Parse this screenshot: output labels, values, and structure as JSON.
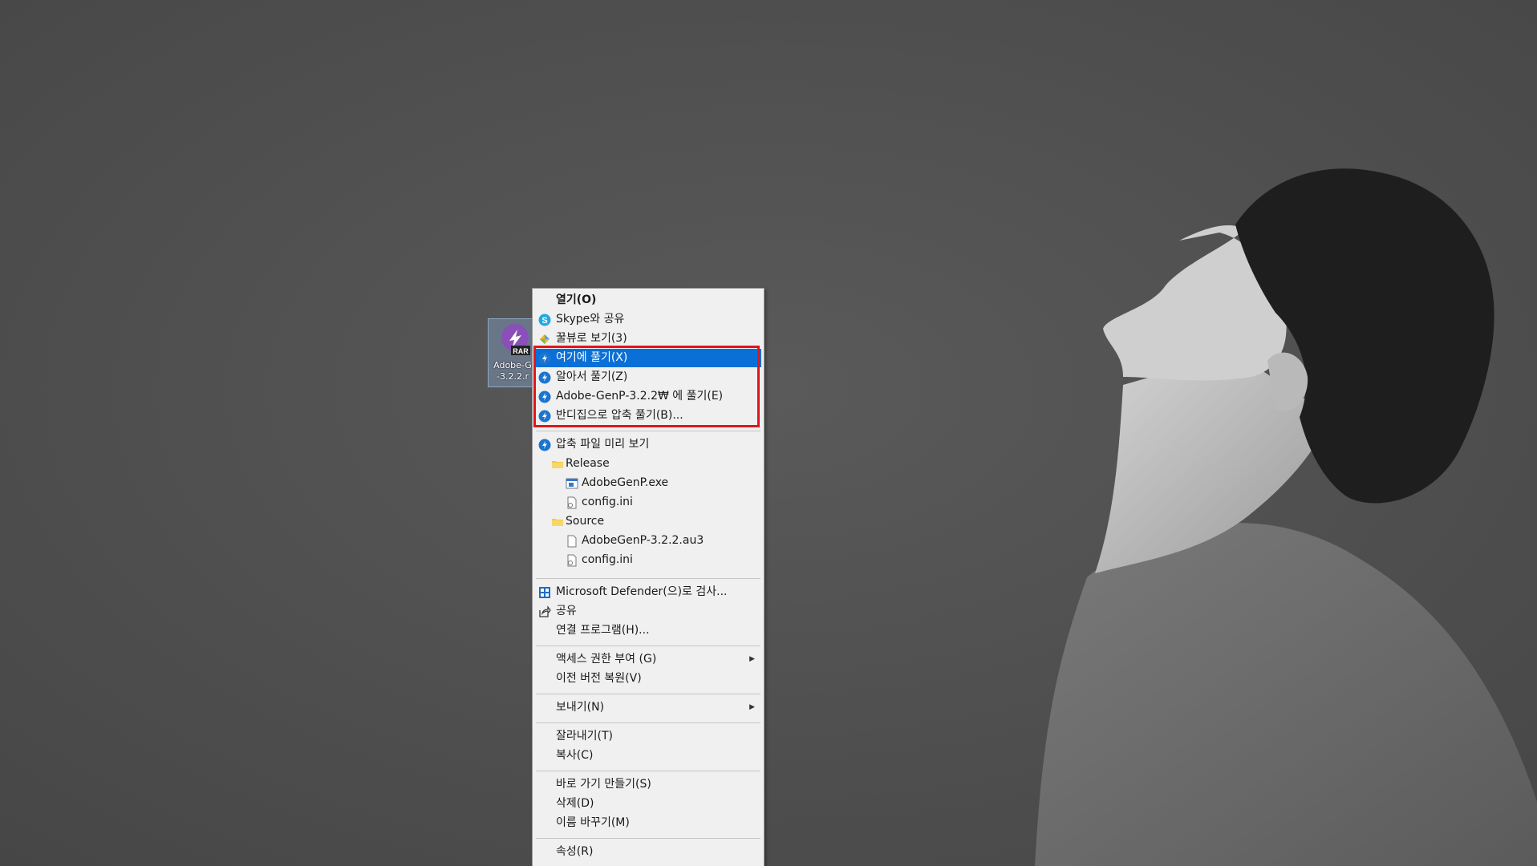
{
  "desktop": {
    "file_icon": {
      "badge": "RAR",
      "label": "Adobe-G\n-3.2.2.r",
      "icon": "bandizip-rar-icon"
    }
  },
  "context_menu": {
    "items": [
      {
        "label": "열기(O)",
        "icon": ""
      },
      {
        "label": "Skype와 공유",
        "icon": "skype-icon"
      },
      {
        "label": "꿀뷰로 보기(3)",
        "icon": "honeyview-icon"
      },
      {
        "label": "여기에 풀기(X)",
        "icon": "bandizip-icon",
        "highlighted": true
      },
      {
        "label": "알아서 풀기(Z)",
        "icon": "bandizip-icon"
      },
      {
        "label": "Adobe-GenP-3.2.2₩ 에 풀기(E)",
        "icon": "bandizip-icon"
      },
      {
        "label": "반디집으로 압축 풀기(B)...",
        "icon": "bandizip-icon"
      },
      {
        "label": "압축 파일 미리 보기",
        "icon": "bandizip-icon"
      },
      {
        "label": "Release",
        "icon": "folder-icon"
      },
      {
        "label": "AdobeGenP.exe",
        "icon": "exe-icon"
      },
      {
        "label": "config.ini",
        "icon": "ini-file-icon"
      },
      {
        "label": "Source",
        "icon": "folder-icon"
      },
      {
        "label": "AdobeGenP-3.2.2.au3",
        "icon": "file-icon"
      },
      {
        "label": "config.ini",
        "icon": "ini-file-icon"
      },
      {
        "label": "Microsoft Defender(으)로 검사...",
        "icon": "defender-icon"
      },
      {
        "label": "공유",
        "icon": "share-icon"
      },
      {
        "label": "연결 프로그램(H)...",
        "icon": ""
      },
      {
        "label": "액세스 권한 부여 (G)",
        "icon": "",
        "submenu": true
      },
      {
        "label": "이전 버전 복원(V)",
        "icon": ""
      },
      {
        "label": "보내기(N)",
        "icon": "",
        "submenu": true
      },
      {
        "label": "잘라내기(T)",
        "icon": ""
      },
      {
        "label": "복사(C)",
        "icon": ""
      },
      {
        "label": "바로 가기 만들기(S)",
        "icon": ""
      },
      {
        "label": "삭제(D)",
        "icon": ""
      },
      {
        "label": "이름 바꾸기(M)",
        "icon": ""
      },
      {
        "label": "속성(R)",
        "icon": ""
      }
    ],
    "submenu_arrow": "▶"
  },
  "colors": {
    "highlight": "#0a6fd6",
    "annotation_box": "#e0161b",
    "menu_bg": "#f0f0f0",
    "bandizip_blue": "#1b75d0"
  }
}
